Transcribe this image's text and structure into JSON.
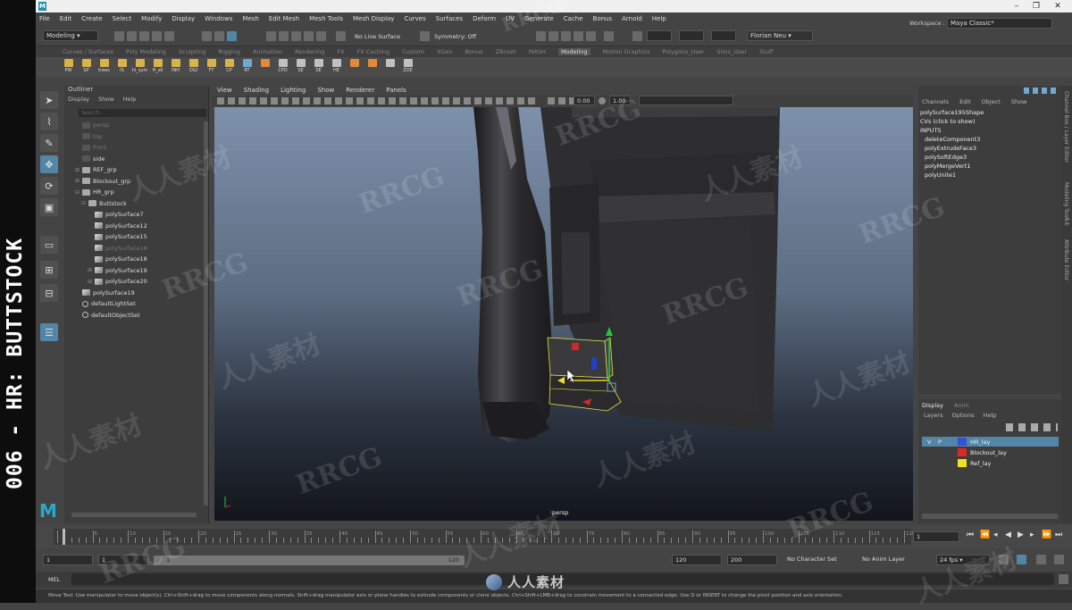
{
  "window": {
    "title_icon": "maya-logo-icon"
  },
  "menubar": [
    "File",
    "Edit",
    "Create",
    "Select",
    "Modify",
    "Display",
    "Windows",
    "Mesh",
    "Edit Mesh",
    "Mesh Tools",
    "Mesh Display",
    "Curves",
    "Surfaces",
    "Deform",
    "UV",
    "Generate",
    "Cache",
    "Bonus",
    "Arnold",
    "Help"
  ],
  "status": {
    "mode": "Modeling",
    "live_surface": "No Live Surface",
    "symmetry": "Symmetry: Off",
    "user": "Florian Neu",
    "workspace_label": "Workspace :",
    "workspace": "Maya Classic*"
  },
  "shelf_tabs": [
    "Curves / Surfaces",
    "Poly Modeling",
    "Sculpting",
    "Rigging",
    "Animation",
    "Rendering",
    "FX",
    "FX Caching",
    "Custom",
    "XGen",
    "Bonus",
    "ZBrush",
    "MASH",
    "Motion Graphics",
    "Polygons_User",
    "Sims_User",
    "Stuff"
  ],
  "shelf_active": "Modeling",
  "shelf_icons": [
    {
      "label": "PW",
      "kind": "folder"
    },
    {
      "label": "SP",
      "kind": "folder"
    },
    {
      "label": "trees",
      "kind": "folder"
    },
    {
      "label": "IS",
      "kind": "folder"
    },
    {
      "label": "hi_sym",
      "kind": "folder"
    },
    {
      "label": "H_all",
      "kind": "folder"
    },
    {
      "label": "INH",
      "kind": "folder"
    },
    {
      "label": "OGI",
      "kind": "folder"
    },
    {
      "label": "FT",
      "kind": "folder"
    },
    {
      "label": "CP",
      "kind": "folder"
    },
    {
      "label": "RT",
      "kind": "blue"
    },
    {
      "label": "",
      "kind": "orange"
    },
    {
      "label": "CPD",
      "kind": "poly"
    },
    {
      "label": "SE",
      "kind": "poly"
    },
    {
      "label": "SE",
      "kind": "poly"
    },
    {
      "label": "HE",
      "kind": "poly"
    },
    {
      "label": "",
      "kind": "orange"
    },
    {
      "label": "",
      "kind": "orange"
    },
    {
      "label": "",
      "kind": "poly"
    },
    {
      "label": "ZOE",
      "kind": "poly"
    }
  ],
  "outliner": {
    "title": "Outliner",
    "menu": [
      "Display",
      "Show",
      "Help"
    ],
    "search_placeholder": "Search...",
    "rows": [
      {
        "label": "persp",
        "indent": 1,
        "icon": "cam",
        "dim": true
      },
      {
        "label": "top",
        "indent": 1,
        "icon": "cam",
        "dim": true
      },
      {
        "label": "front",
        "indent": 1,
        "icon": "cam",
        "dim": true
      },
      {
        "label": "side",
        "indent": 1,
        "icon": "cam",
        "dim": false
      },
      {
        "label": "REF_grp",
        "indent": 1,
        "icon": "grp",
        "exp": "⊞",
        "dim": false
      },
      {
        "label": "Blockout_grp",
        "indent": 1,
        "icon": "grp",
        "exp": "⊞",
        "dim": false
      },
      {
        "label": "HR_grp",
        "indent": 1,
        "icon": "grp",
        "exp": "⊟",
        "dim": false
      },
      {
        "label": "Buttstock",
        "indent": 2,
        "icon": "grp",
        "exp": "⊟",
        "dim": false
      },
      {
        "label": "polySurface7",
        "indent": 3,
        "icon": "poly",
        "dim": false
      },
      {
        "label": "polySurface12",
        "indent": 3,
        "icon": "poly",
        "dim": false
      },
      {
        "label": "polySurface15",
        "indent": 3,
        "icon": "poly",
        "dim": false
      },
      {
        "label": "polySurface16",
        "indent": 3,
        "icon": "poly",
        "dim": true
      },
      {
        "label": "polySurface18",
        "indent": 3,
        "icon": "poly",
        "dim": false
      },
      {
        "label": "polySurface19",
        "indent": 3,
        "icon": "poly",
        "exp": "⊞",
        "dim": false
      },
      {
        "label": "polySurface20",
        "indent": 3,
        "icon": "poly",
        "exp": "⊞",
        "dim": false
      },
      {
        "label": "polySurface19",
        "indent": 1,
        "icon": "poly",
        "dim": false
      },
      {
        "label": "defaultLightSet",
        "indent": 1,
        "icon": "set",
        "dim": false
      },
      {
        "label": "defaultObjectSet",
        "indent": 1,
        "icon": "set",
        "dim": false
      }
    ]
  },
  "viewport": {
    "menu": [
      "View",
      "Shading",
      "Lighting",
      "Show",
      "Renderer",
      "Panels"
    ],
    "field_a": "0.00",
    "field_b": "1.00",
    "camera_label": "persp"
  },
  "channel_box": {
    "menu": [
      "Channels",
      "Edit",
      "Object",
      "Show"
    ],
    "object": "polySurface195Shape",
    "cvs": "CVs (click to show)",
    "inputs_label": "INPUTS",
    "inputs": [
      "deleteComponent3",
      "polyExtrudeFace3",
      "polySoftEdge3",
      "polyMergeVert1",
      "polyUnite1"
    ]
  },
  "layers": {
    "tabs": [
      "Display",
      "Anim"
    ],
    "menu": [
      "Layers",
      "Options",
      "Help"
    ],
    "rows": [
      {
        "v": "V",
        "p": "P",
        "name": "HR_lay",
        "color": "#2f55d4",
        "selected": true
      },
      {
        "v": "",
        "p": "",
        "name": "Blockout_lay",
        "color": "#e0281e",
        "selected": false
      },
      {
        "v": "",
        "p": "",
        "name": "Ref_lay",
        "color": "#f0e020",
        "selected": false
      }
    ]
  },
  "side_tabs": [
    "Channel Box / Layer Editor",
    "Modeling Toolkit",
    "Attribute Editor"
  ],
  "timeline": {
    "ticks": [
      "5",
      "10",
      "15",
      "20",
      "25",
      "30",
      "35",
      "40",
      "45",
      "50",
      "55",
      "60",
      "65",
      "70",
      "75",
      "80",
      "85",
      "90",
      "95",
      "100",
      "105",
      "110",
      "115",
      "120"
    ],
    "current_frame": "1"
  },
  "range": {
    "start": "1",
    "start_inner": "1",
    "slider_start": "1",
    "slider_end": "120",
    "end_inner": "120",
    "end": "200",
    "char_set": "No Character Set",
    "anim_layer": "No Anim Layer",
    "fps": "24 fps"
  },
  "mel_label": "MEL",
  "help_line": "Move Tool: Use manipulator to move object(s). Ctrl+Shift+drag to move components along normals. Shift+drag manipulator axis or plane handles to extrude components or clone objects. Ctrl+Shift+LMB+drag to constrain movement to a connected edge. Use D or INSERT to change the pivot position and axis orientation.",
  "overlay": {
    "video_title": "006 - HR: BUTTSTOCK",
    "watermark_latin": "RRCG",
    "watermark_cn": "人人素材",
    "center_logo": "人人素材"
  }
}
